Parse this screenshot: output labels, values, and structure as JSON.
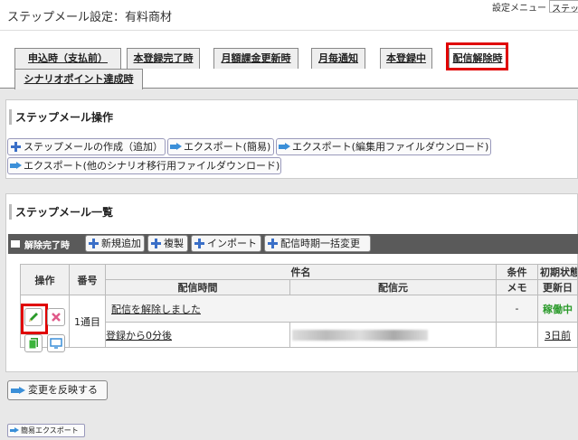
{
  "header": {
    "title": "ステップメール設定：有料商材",
    "menu_label": "設定メニュー",
    "menu_value": "ステップ"
  },
  "tabs": [
    {
      "label": "申込時（支払前）"
    },
    {
      "label": "本登録完了時"
    },
    {
      "label": "月額課金更新時"
    },
    {
      "label": "月毎通知"
    },
    {
      "label": "本登録中"
    },
    {
      "label": "配信解除時"
    },
    {
      "label": "シナリオポイント達成時"
    }
  ],
  "operations": {
    "title": "ステップメール操作",
    "buttons": [
      {
        "label": "ステップメールの作成（追加）",
        "icon": "plus-icon"
      },
      {
        "label": "エクスポート(簡易)",
        "icon": "arrow-icon"
      },
      {
        "label": "エクスポート(編集用ファイルダウンロード)",
        "icon": "arrow-icon"
      },
      {
        "label": "エクスポート(他のシナリオ移行用ファイルダウンロード)",
        "icon": "arrow-icon"
      }
    ]
  },
  "list": {
    "title": "ステップメール一覧",
    "group": {
      "label": "解除完了時",
      "buttons": [
        {
          "label": "新規追加"
        },
        {
          "label": "複製"
        },
        {
          "label": "インポート"
        },
        {
          "label": "配信時期一括変更"
        }
      ]
    },
    "columns": {
      "operation": "操作",
      "number": "番号",
      "subject": "件名",
      "send_time": "配信時間",
      "sender": "配信元",
      "condition": "条件",
      "memo": "メモ",
      "initial_state": "初期状態",
      "updated": "更新日"
    },
    "rows": [
      {
        "number": "1通目",
        "subject": "配信を解除しました",
        "send_time": "登録から0分後",
        "condition": "-",
        "status": "稼働中",
        "updated": "3日前"
      }
    ]
  },
  "footer": {
    "apply_label": "変更を反映する",
    "simple_export_label": "簡易エクスポート"
  },
  "colors": {
    "highlight": "#e00000",
    "status_active": "#2a9a2a",
    "accent_blue": "#3a6fc7"
  }
}
